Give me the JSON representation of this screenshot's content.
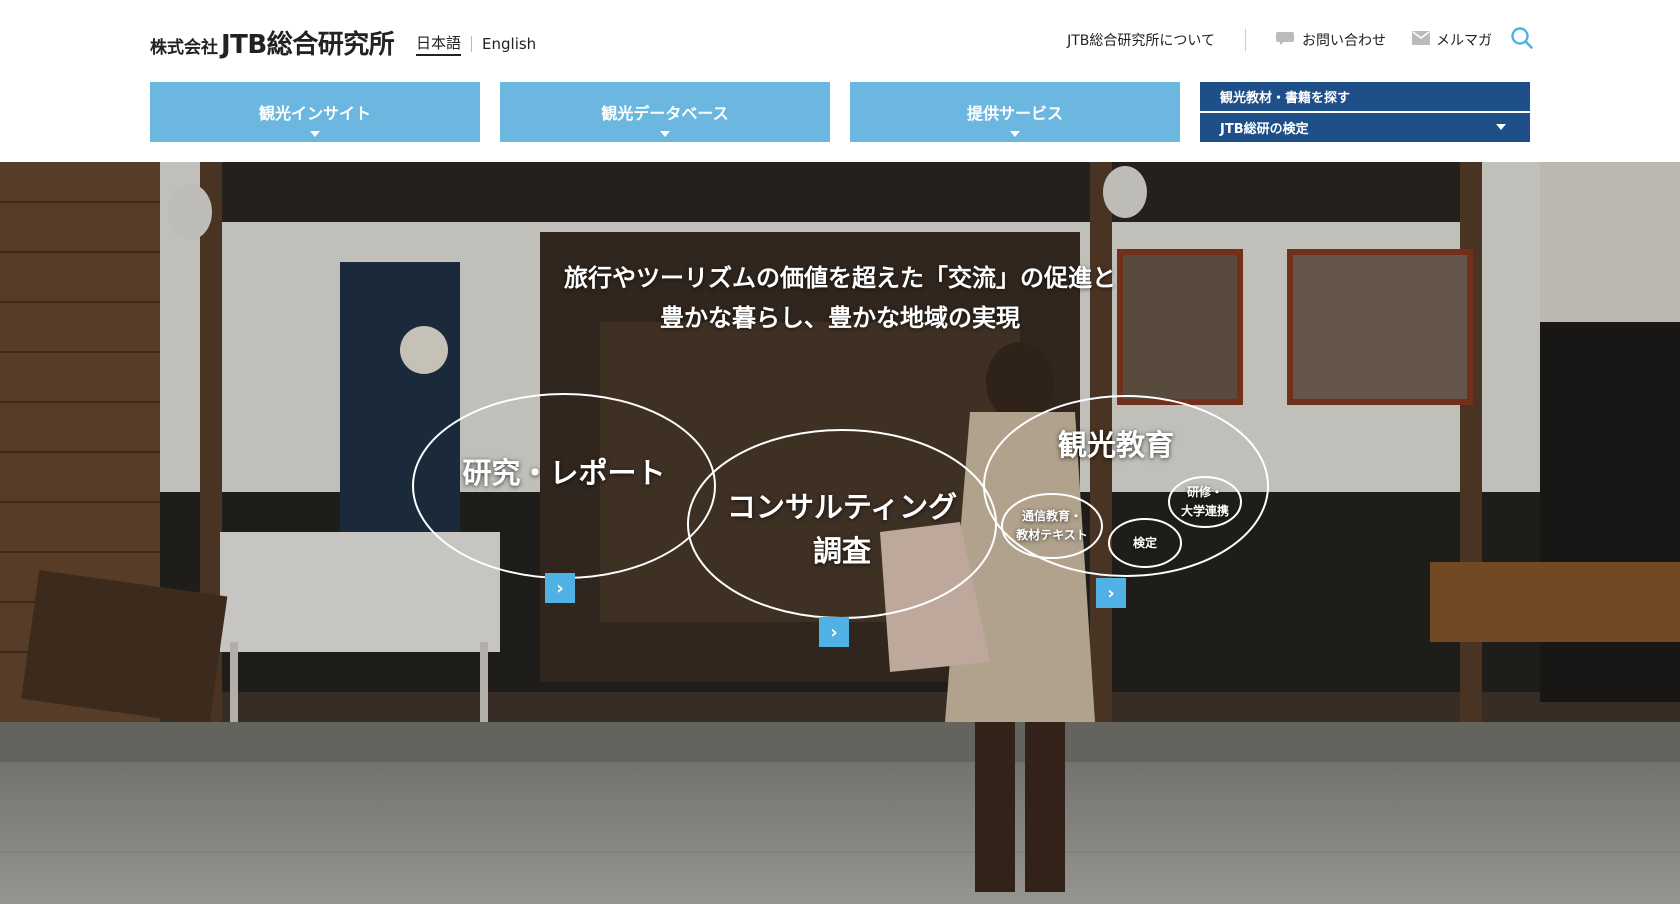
{
  "header": {
    "logo_small": "株式会社",
    "logo_big": "JTB総合研究所",
    "lang_ja": "日本語",
    "lang_en": "English",
    "about": "JTB総合研究所について",
    "contact": "お問い合わせ",
    "mailmag": "メルマガ"
  },
  "nav": {
    "items": [
      {
        "label": "観光インサイト"
      },
      {
        "label": "観光データベース"
      },
      {
        "label": "提供サービス"
      }
    ],
    "dark": [
      "観光教材・書籍を探す",
      "JTB総研の検定"
    ]
  },
  "hero": {
    "tagline_1": "旅行やツーリズムの価値を超えた「交流」の促進と",
    "tagline_2": "豊かな暮らし、豊かな地域の実現",
    "bubble_research": "研究・レポート",
    "bubble_consult_1": "コンサルティング",
    "bubble_consult_2": "調査",
    "bubble_edu": "観光教育",
    "sub_comm_1": "通信教育・",
    "sub_comm_2": "教材テキスト",
    "sub_exam": "検定",
    "sub_training_1": "研修・",
    "sub_training_2": "大学連携",
    "arrow": "›"
  },
  "colors": {
    "nav_light": "#6cb7e0",
    "nav_dark": "#1f4f88",
    "arrow_button": "#4fb1e4",
    "search_icon": "#4fb1e4"
  },
  "icons": [
    "speech-bubble-icon",
    "envelope-icon",
    "search-icon",
    "caret-down-icon",
    "chevron-right-icon"
  ]
}
